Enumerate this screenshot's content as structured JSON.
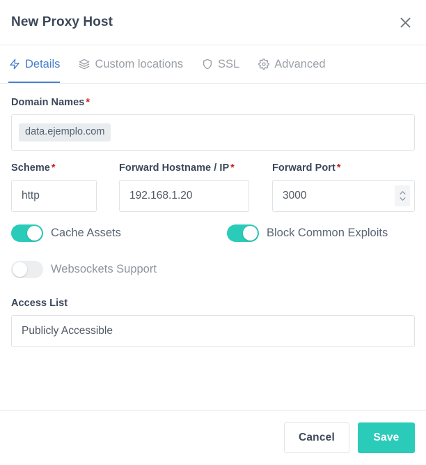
{
  "header": {
    "title": "New Proxy Host",
    "close_icon": "close-icon"
  },
  "tabs": [
    {
      "label": "Details",
      "icon": "bolt-icon",
      "active": true
    },
    {
      "label": "Custom locations",
      "icon": "layers-icon",
      "active": false
    },
    {
      "label": "SSL",
      "icon": "shield-icon",
      "active": false
    },
    {
      "label": "Advanced",
      "icon": "gear-icon",
      "active": false
    }
  ],
  "form": {
    "domain_names": {
      "label": "Domain Names",
      "required_mark": "*",
      "tags": [
        "data.ejemplo.com"
      ]
    },
    "scheme": {
      "label": "Scheme",
      "required_mark": "*",
      "value": "http"
    },
    "forward_hostname": {
      "label": "Forward Hostname / IP",
      "required_mark": "*",
      "value": "192.168.1.20"
    },
    "forward_port": {
      "label": "Forward Port",
      "required_mark": "*",
      "value": "3000"
    },
    "toggles": [
      {
        "label": "Cache Assets",
        "on": true
      },
      {
        "label": "Block Common Exploits",
        "on": true
      },
      {
        "label": "Websockets Support",
        "on": false
      }
    ],
    "access_list": {
      "label": "Access List",
      "value": "Publicly Accessible"
    }
  },
  "footer": {
    "cancel_label": "Cancel",
    "save_label": "Save"
  },
  "colors": {
    "accent_teal": "#2bcbba",
    "accent_blue": "#467fcf",
    "required_red": "#cd201f",
    "chip_bg": "#e9ecef",
    "border": "#dfe3e7"
  }
}
